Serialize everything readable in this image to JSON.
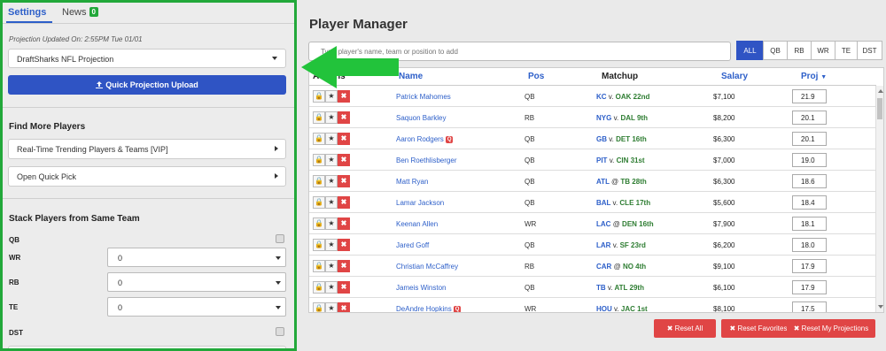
{
  "sidebar": {
    "tabs": [
      {
        "label": "Settings"
      },
      {
        "label": "News",
        "badge": "0"
      }
    ],
    "projection_updated": "Projection Updated On: 2:55PM Tue 01/01",
    "projection_source": "DraftSharks NFL Projection",
    "upload_button": "Quick Projection Upload",
    "find_more_title": "Find More Players",
    "find_links": [
      "Real-Time Trending Players & Teams [VIP]",
      "Open Quick Pick"
    ],
    "stack_title": "Stack Players from Same Team",
    "stack_rows": [
      {
        "label": "QB",
        "type": "checkbox"
      },
      {
        "label": "WR",
        "type": "select",
        "value": "0"
      },
      {
        "label": "RB",
        "type": "select",
        "value": "0"
      },
      {
        "label": "TE",
        "type": "select",
        "value": "0"
      },
      {
        "label": "DST",
        "type": "checkbox"
      }
    ]
  },
  "main": {
    "title": "Player Manager",
    "search_placeholder": "Type player's name, team or position to add",
    "position_filters": [
      "ALL",
      "QB",
      "RB",
      "WR",
      "TE",
      "DST"
    ],
    "active_filter": "ALL",
    "columns": {
      "actions": "Actions",
      "name": "Name",
      "pos": "Pos",
      "matchup": "Matchup",
      "salary": "Salary",
      "proj": "Proj"
    },
    "players": [
      {
        "name": "Patrick Mahomes",
        "pos": "QB",
        "team": "KC",
        "sep": "v.",
        "opp": "OAK 22nd",
        "salary": "$7,100",
        "proj": "21.9",
        "badge": ""
      },
      {
        "name": "Saquon Barkley",
        "pos": "RB",
        "team": "NYG",
        "sep": "v.",
        "opp": "DAL 9th",
        "salary": "$8,200",
        "proj": "20.1",
        "badge": ""
      },
      {
        "name": "Aaron Rodgers",
        "pos": "QB",
        "team": "GB",
        "sep": "v.",
        "opp": "DET 16th",
        "salary": "$6,300",
        "proj": "20.1",
        "badge": "Q"
      },
      {
        "name": "Ben Roethlisberger",
        "pos": "QB",
        "team": "PIT",
        "sep": "v.",
        "opp": "CIN 31st",
        "salary": "$7,000",
        "proj": "19.0",
        "badge": ""
      },
      {
        "name": "Matt Ryan",
        "pos": "QB",
        "team": "ATL",
        "sep": "@",
        "opp": "TB 28th",
        "salary": "$6,300",
        "proj": "18.6",
        "badge": ""
      },
      {
        "name": "Lamar Jackson",
        "pos": "QB",
        "team": "BAL",
        "sep": "v.",
        "opp": "CLE 17th",
        "salary": "$5,600",
        "proj": "18.4",
        "badge": ""
      },
      {
        "name": "Keenan Allen",
        "pos": "WR",
        "team": "LAC",
        "sep": "@",
        "opp": "DEN 16th",
        "salary": "$7,900",
        "proj": "18.1",
        "badge": ""
      },
      {
        "name": "Jared Goff",
        "pos": "QB",
        "team": "LAR",
        "sep": "v.",
        "opp": "SF 23rd",
        "salary": "$6,200",
        "proj": "18.0",
        "badge": ""
      },
      {
        "name": "Christian McCaffrey",
        "pos": "RB",
        "team": "CAR",
        "sep": "@",
        "opp": "NO 4th",
        "salary": "$9,100",
        "proj": "17.9",
        "badge": ""
      },
      {
        "name": "Jameis Winston",
        "pos": "QB",
        "team": "TB",
        "sep": "v.",
        "opp": "ATL 29th",
        "salary": "$6,100",
        "proj": "17.9",
        "badge": ""
      },
      {
        "name": "DeAndre Hopkins",
        "pos": "WR",
        "team": "HOU",
        "sep": "v.",
        "opp": "JAC 1st",
        "salary": "$8,100",
        "proj": "17.5",
        "badge": "Q"
      }
    ],
    "reset_buttons": [
      "Reset All",
      "Reset Favorites",
      "Reset My Projections"
    ]
  },
  "colors": {
    "accent": "#2f54c4",
    "danger": "#e04545",
    "highlight": "#22a83a"
  },
  "icons": [
    "lock-icon",
    "star-icon",
    "close-icon",
    "upload-icon",
    "sort-desc-icon"
  ]
}
